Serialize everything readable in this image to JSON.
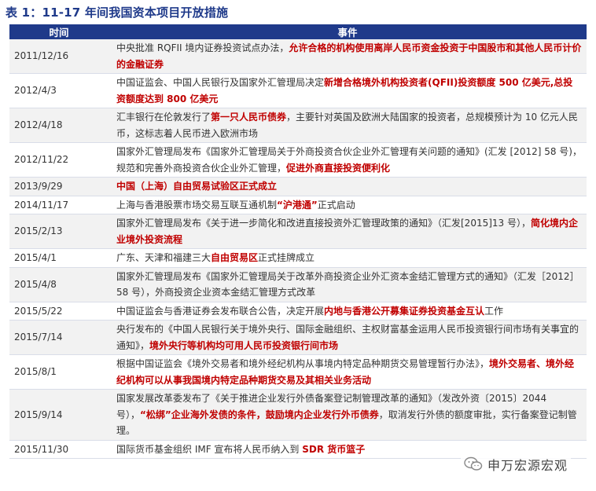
{
  "title": "表 1：11-17 年间我国资本项目开放措施",
  "headers": {
    "time": "时间",
    "event": "事件"
  },
  "rows": [
    {
      "date": "2011/12/16",
      "segments": [
        {
          "t": "中央批准 RQFII 境内证券投资试点办法，",
          "h": false
        },
        {
          "t": "允许合格的机构使用离岸人民币资金投资于中国股市和其他人民币计价的金融证券",
          "h": true
        }
      ]
    },
    {
      "date": "2012/4/3",
      "segments": [
        {
          "t": "中国证监会、中国人民银行及国家外汇管理局决定",
          "h": false
        },
        {
          "t": "新增合格境外机构投资者(QFII)投资额度 500 亿美元,总投资额度达到 800 亿美元",
          "h": true
        }
      ]
    },
    {
      "date": "2012/4/18",
      "segments": [
        {
          "t": "汇丰银行在伦敦发行了",
          "h": false
        },
        {
          "t": "第一只人民币债券",
          "h": true
        },
        {
          "t": "，主要针对英国及欧洲大陆国家的投资者，总规模预计为 10 亿元人民币，这标志着人民币进入欧洲市场",
          "h": false
        }
      ]
    },
    {
      "date": "2012/11/22",
      "segments": [
        {
          "t": "国家外汇管理局发布《国家外汇管理局关于外商投资合伙企业外汇管理有关问题的通知》(汇发 [2012] 58 号)，规范和完善外商投资合伙企业外汇管理，",
          "h": false
        },
        {
          "t": "促进外商直接投资便利化",
          "h": true
        }
      ]
    },
    {
      "date": "2013/9/29",
      "segments": [
        {
          "t": "中国（上海）自由贸易试验区正式成立",
          "h": true
        }
      ]
    },
    {
      "date": "2014/11/17",
      "segments": [
        {
          "t": "上海与香港股票市场交易互联互通机制",
          "h": false
        },
        {
          "t": "“沪港通”",
          "h": true
        },
        {
          "t": "正式启动",
          "h": false
        }
      ]
    },
    {
      "date": "2015/2/13",
      "segments": [
        {
          "t": "国家外汇管理局发布《关于进一步简化和改进直接投资外汇管理政策的通知》（汇发[2015]13 号），",
          "h": false
        },
        {
          "t": "简化境内企业境外投资流程",
          "h": true
        }
      ]
    },
    {
      "date": "2015/4/1",
      "segments": [
        {
          "t": "广东、天津和福建三大",
          "h": false
        },
        {
          "t": "自由贸易区",
          "h": true
        },
        {
          "t": "正式挂牌成立",
          "h": false
        }
      ]
    },
    {
      "date": "2015/4/8",
      "segments": [
        {
          "t": "国家外汇管理局发布《国家外汇管理局关于改革外商投资企业外汇资本金结汇管理方式的通知》（汇发［2012］58 号），外商投资企业资本金结汇管理方式改革",
          "h": false
        }
      ]
    },
    {
      "date": "2015/5/22",
      "segments": [
        {
          "t": "中国证监会与香港证券会发布联合公告，决定开展",
          "h": false
        },
        {
          "t": "内地与香港公开募集证券投资基金互认",
          "h": true
        },
        {
          "t": "工作",
          "h": false
        }
      ]
    },
    {
      "date": "2015/7/14",
      "segments": [
        {
          "t": "央行发布的《中国人民银行关于境外央行、国际金融组织、主权财富基金运用人民币投资银行间市场有关事宜的通知》，",
          "h": false
        },
        {
          "t": "境外央行等机构均可用人民币投资银行间市场",
          "h": true
        }
      ]
    },
    {
      "date": "2015/8/1",
      "segments": [
        {
          "t": "根据中国证监会《境外交易者和境外经纪机构从事境内特定品种期货交易管理暂行办法》，",
          "h": false
        },
        {
          "t": "境外交易者、境外经纪机构可以从事我国境内特定品种期货交易及其相关业务活动",
          "h": true
        }
      ]
    },
    {
      "date": "2015/9/14",
      "segments": [
        {
          "t": "国家发展改革委发布了《关于推进企业发行外债备案登记制管理改革的通知》（发改外资〔2015〕2044 号），",
          "h": false
        },
        {
          "t": "“松绑”企业海外发债的条件，鼓励境内企业发行外币债券",
          "h": true
        },
        {
          "t": "，取消发行外债的额度审批，实行备案登记制管理。",
          "h": false
        }
      ]
    },
    {
      "date": "2015/11/30",
      "segments": [
        {
          "t": "国际货币基金组织 IMF 宣布将人民币纳入到 ",
          "h": false
        },
        {
          "t": "SDR 货币篮子",
          "h": true
        }
      ]
    }
  ],
  "watermark": {
    "text": "申万宏源宏观",
    "icon": "wechat-icon"
  }
}
